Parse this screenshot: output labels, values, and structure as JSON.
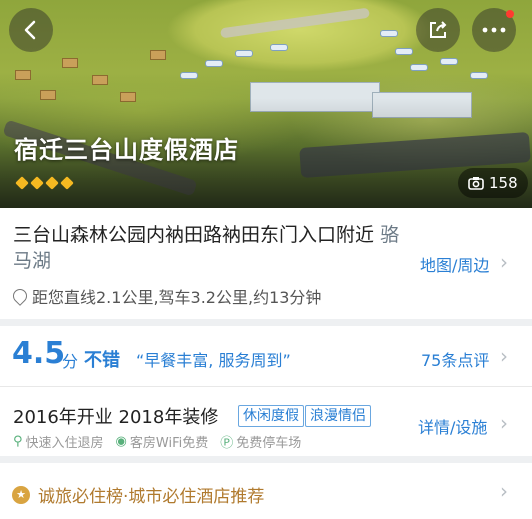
{
  "hero": {
    "title": "宿迁三台山度假酒店",
    "diamond_count": 4,
    "photo_count": "158"
  },
  "icons": {
    "back": "chevron-left-icon",
    "share": "share-icon",
    "more": "more-icon",
    "camera": "camera-icon",
    "location": "location-pin-icon"
  },
  "address": {
    "text": "三台山森林公园内衲田路衲田东门入口附近",
    "area": "骆马湖",
    "map_link": "地图/周边",
    "distance": "距您直线2.1公里,驾车3.2公里,约13分钟"
  },
  "score": {
    "value": "4.5",
    "unit": "分",
    "word": "不错",
    "quote": "“早餐丰富, 服务周到”",
    "reviews": "75条点评"
  },
  "info": {
    "years": "2016年开业 2018年装修",
    "tags": [
      "休闲度假",
      "浪漫情侣"
    ],
    "detail_link": "详情/设施",
    "amenities": [
      "快速入住退房",
      "客房WiFi免费",
      "免费停车场"
    ]
  },
  "ranking": {
    "text": "诚旅必住榜·城市必住酒店推荐"
  },
  "colors": {
    "accent": "#2a7fd4",
    "diamond": "#f5b921",
    "rank_text": "#b07a2e"
  }
}
